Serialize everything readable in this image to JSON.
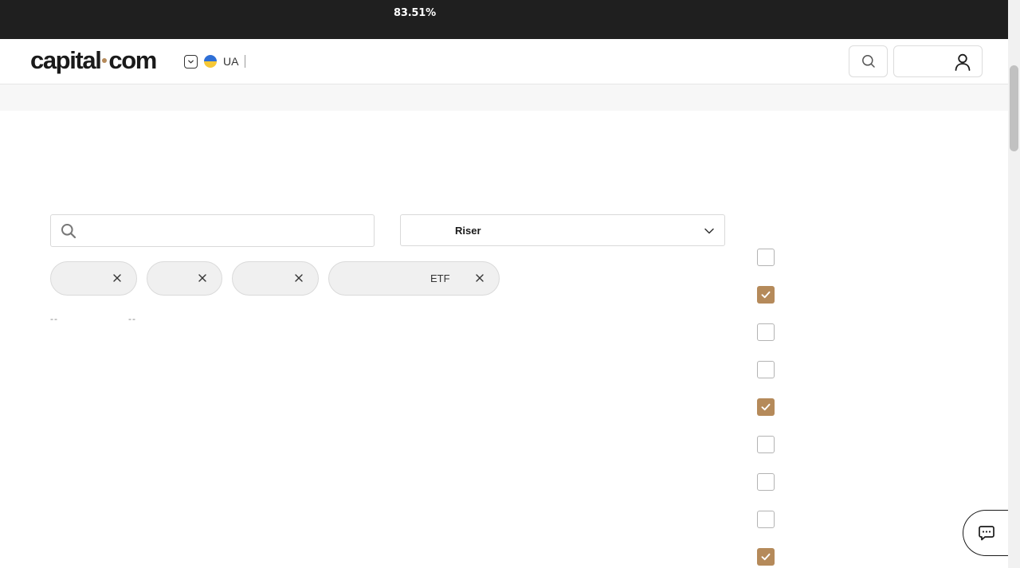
{
  "banner": {
    "percentage": "83.51%"
  },
  "header": {
    "logo_left": "capital",
    "logo_right": "com",
    "region_code": "UA"
  },
  "filters": {
    "search_placeholder": "",
    "sort_selected": "Riser",
    "chips": [
      {
        "label": ""
      },
      {
        "label": ""
      },
      {
        "label": ""
      },
      {
        "label": "ETF"
      }
    ],
    "dash_left": "--",
    "dash_right": "--"
  },
  "checkboxes": [
    {
      "checked": false
    },
    {
      "checked": true
    },
    {
      "checked": false
    },
    {
      "checked": false
    },
    {
      "checked": true
    },
    {
      "checked": false
    },
    {
      "checked": false
    },
    {
      "checked": false
    },
    {
      "checked": true
    }
  ],
  "colors": {
    "accent": "#b58a5a",
    "topbar": "#1f1f1f"
  },
  "icons": {
    "search": "search-icon",
    "user": "user-icon",
    "chat": "chat-icon",
    "close": "close-icon",
    "chevron": "chevron-down-icon",
    "check": "check-icon"
  }
}
